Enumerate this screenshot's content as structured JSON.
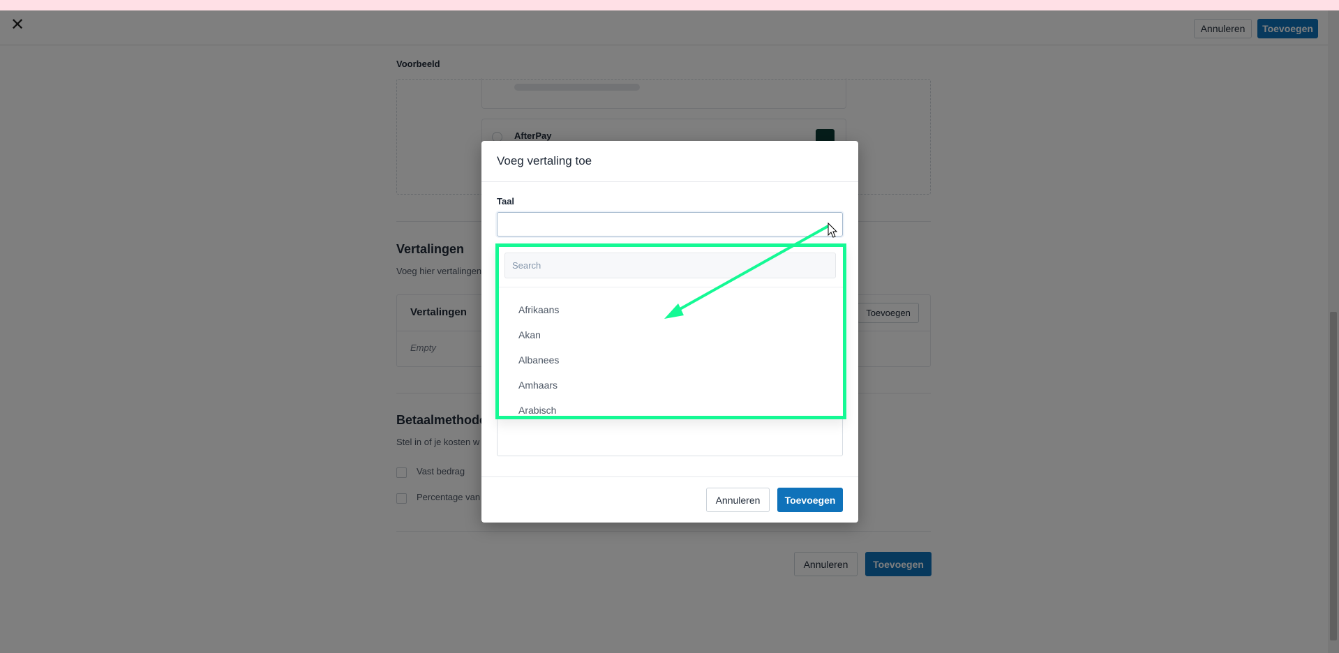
{
  "header": {
    "close_icon": "close-icon",
    "cancel_label": "Annuleren",
    "add_label": "Toevoegen"
  },
  "preview": {
    "label": "Voorbeeld",
    "method_name": "AfterPay",
    "logo_text": "AfterPay"
  },
  "translations": {
    "title": "Vertalingen",
    "subtitle": "Voeg hier vertalingen",
    "table_header": "Vertalingen",
    "add_label": "Toevoegen",
    "empty_label": "Empty"
  },
  "payment": {
    "title": "Betaalmethode",
    "subtitle": "Stel in of je kosten w",
    "options": [
      "Vast bedrag",
      "Percentage van"
    ]
  },
  "footer": {
    "cancel_label": "Annuleren",
    "add_label": "Toevoegen"
  },
  "modal": {
    "title": "Voeg vertaling toe",
    "field_label": "Taal",
    "field_value": "",
    "search_placeholder": "Search",
    "options": [
      "Afrikaans",
      "Akan",
      "Albanees",
      "Amhaars",
      "Arabisch"
    ],
    "cancel_label": "Annuleren",
    "add_label": "Toevoegen"
  },
  "annotation": {
    "highlight_color": "#14f994"
  }
}
